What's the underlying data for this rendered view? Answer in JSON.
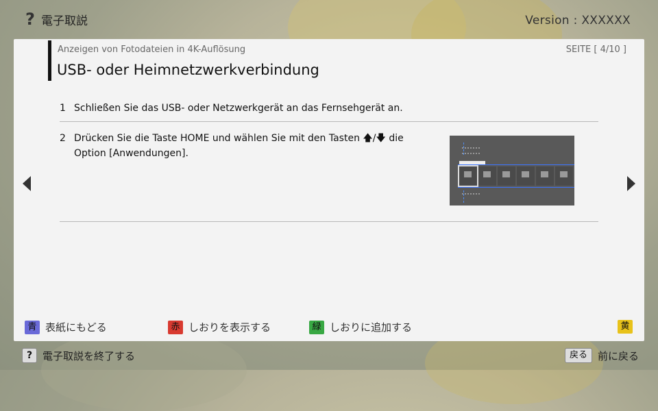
{
  "header": {
    "help_icon": "question-mark-icon",
    "title": "電子取説",
    "version": "Version : XXXXXX"
  },
  "panel": {
    "subtitle": "Anzeigen von Fotodateien in 4K-Auflösung",
    "page_indicator": "SEITE [ 4/10 ]",
    "title": "USB- oder Heimnetzwerkverbindung",
    "steps": [
      {
        "number": "1",
        "text": "Schließen Sie das USB- oder Netzwerkgerät an das Fernsehgerät an."
      },
      {
        "number": "2",
        "line1_pre": "Drücken Sie die Taste HOME und wählen Sie mit den Tasten",
        "up_arrow": "🡅",
        "slash": "/",
        "down_arrow": "🡇",
        "line1_post": "die",
        "line2": "Option [Anwendungen]."
      }
    ]
  },
  "legend": [
    {
      "key": "青",
      "label": "表紙にもどる",
      "color": "#6a6ad8"
    },
    {
      "key": "赤",
      "label": "しおりを表示する",
      "color": "#d83a30"
    },
    {
      "key": "緑",
      "label": "しおりに追加する",
      "color": "#38a843"
    },
    {
      "key": "黄",
      "label": "",
      "color": "#e8c21a"
    }
  ],
  "footer": {
    "exit_key": "?",
    "exit_label": "電子取説を終了する",
    "back_key": "戻る",
    "back_label": "前に戻る"
  }
}
